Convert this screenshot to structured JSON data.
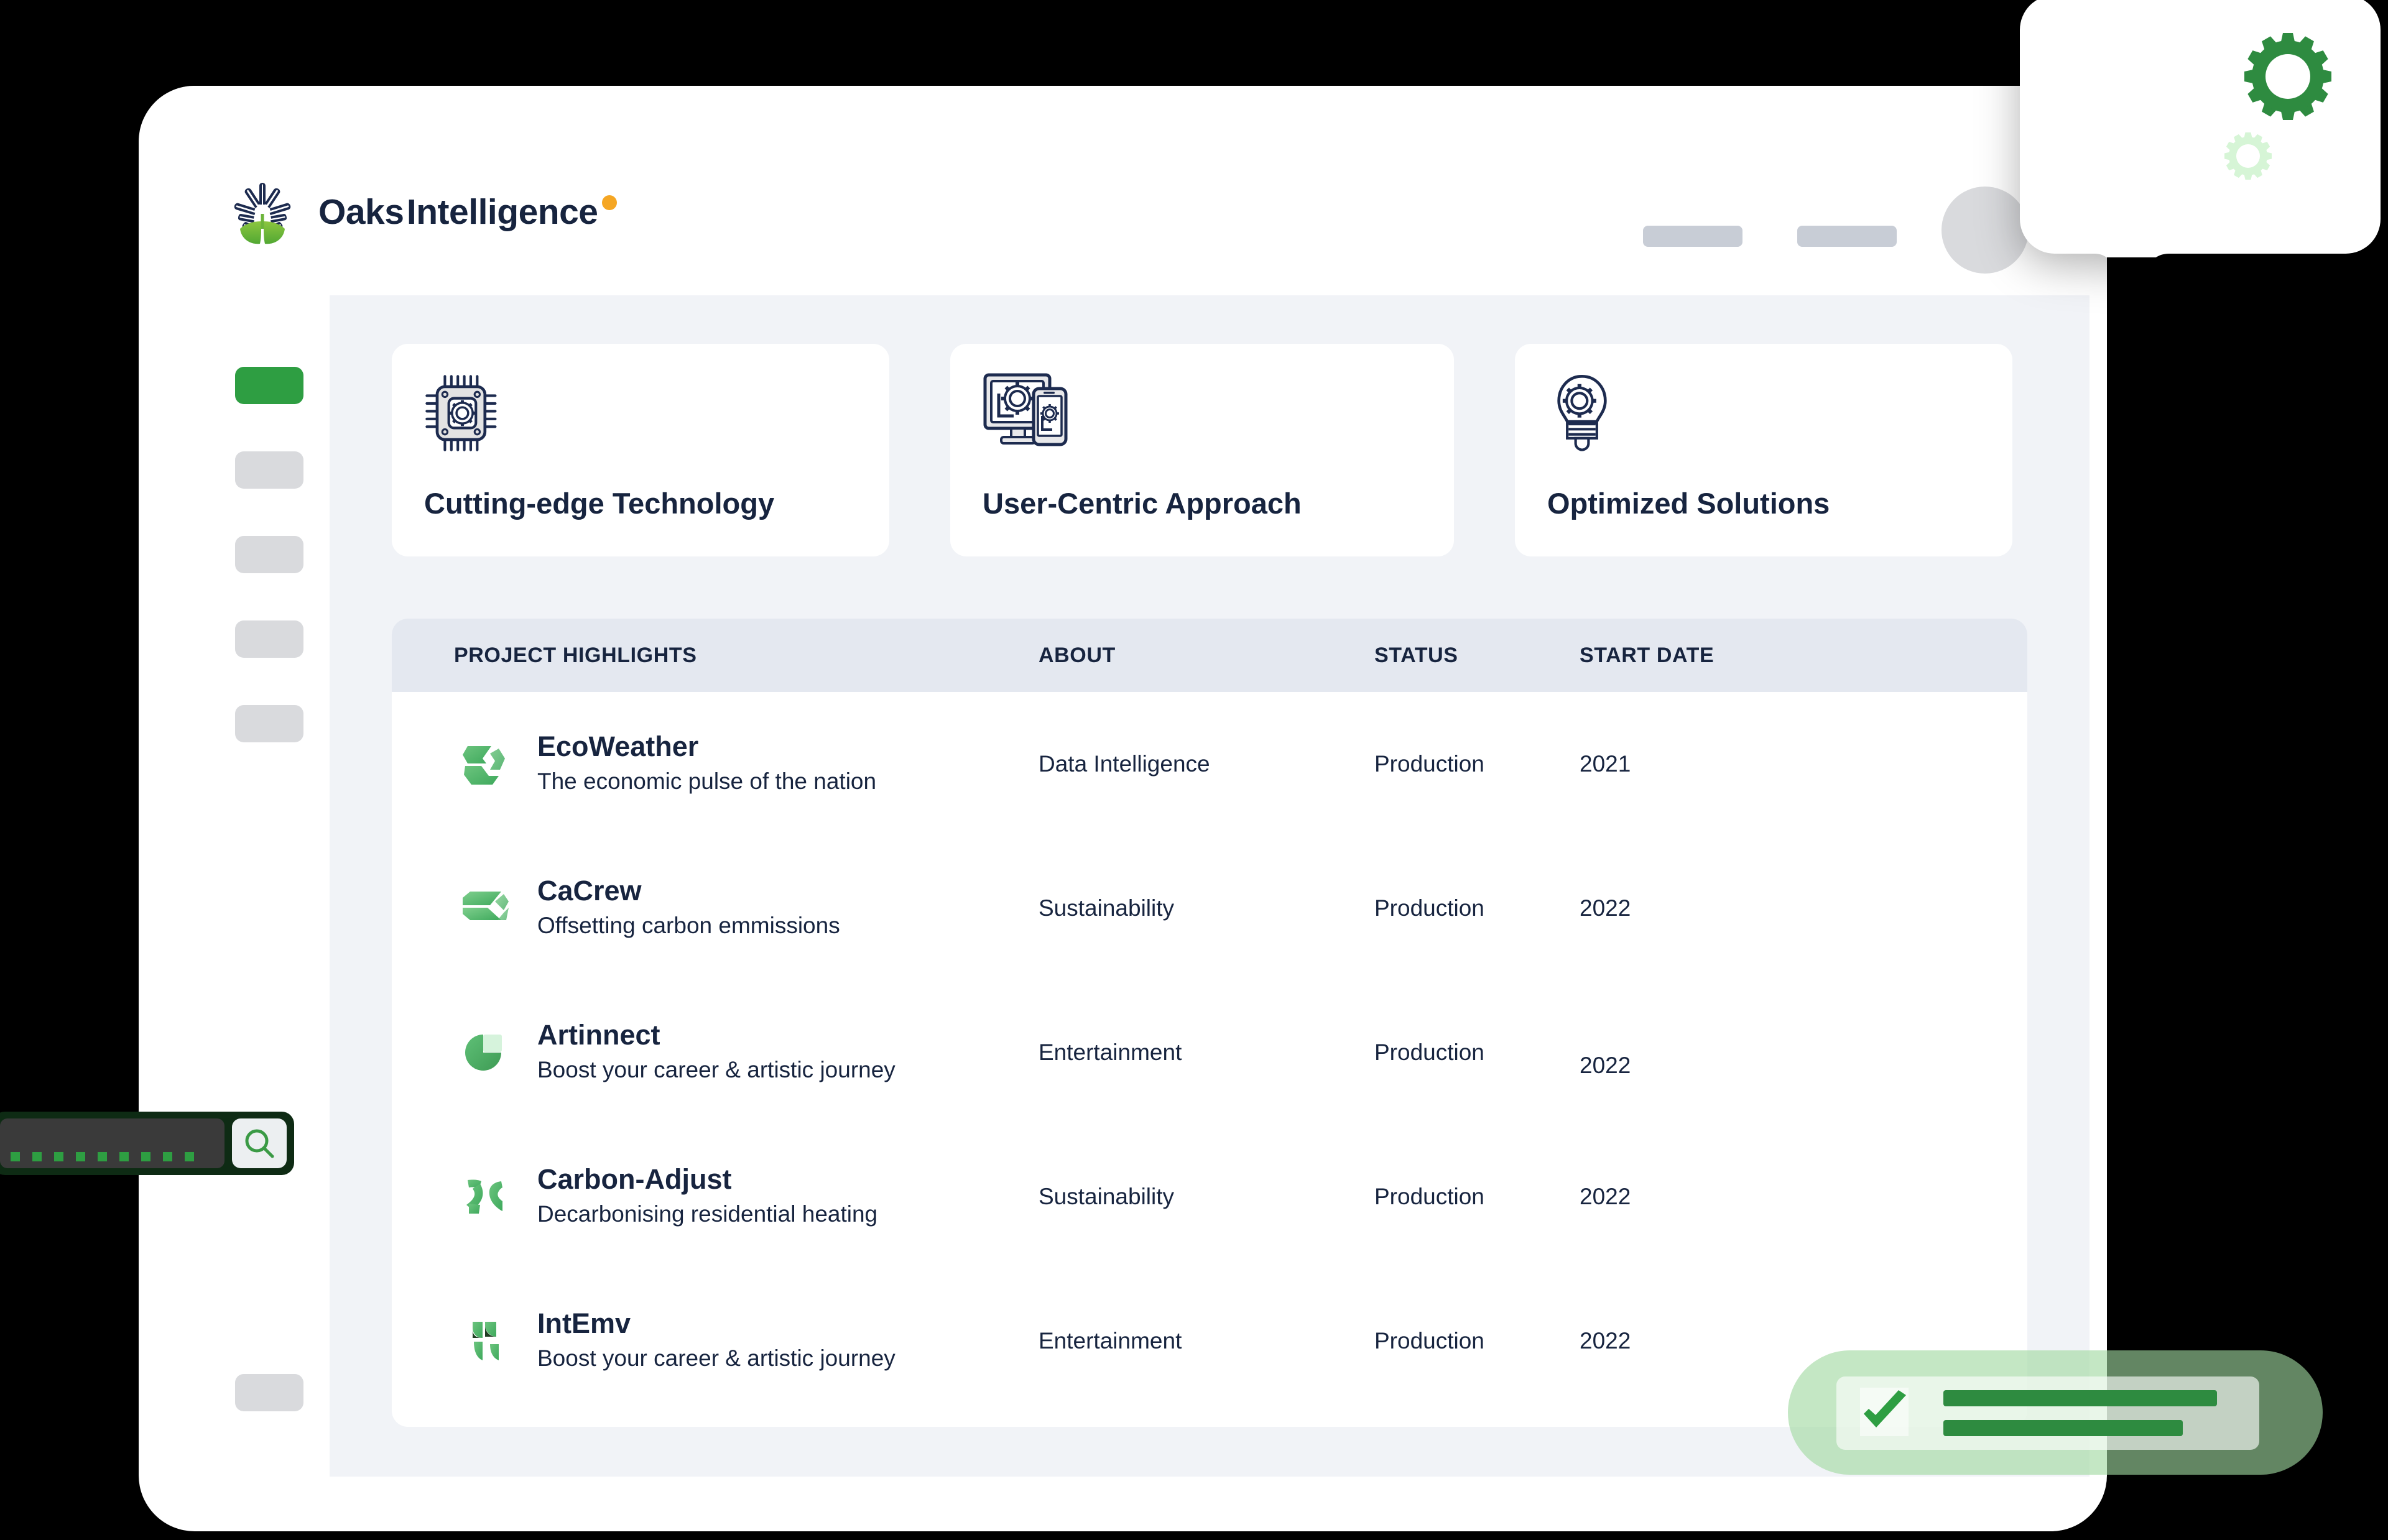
{
  "brand": {
    "line1": "Oaks",
    "line2": "Intelligence",
    "accent_orange": "#f5a623",
    "dark": "#17243f",
    "green": "#2e9e42"
  },
  "header": {
    "placeholder_pill_1": "",
    "placeholder_pill_2": "",
    "avatar_label": ""
  },
  "sidebar": {
    "items": [
      {
        "label": "",
        "active": true
      },
      {
        "label": "",
        "active": false
      },
      {
        "label": "",
        "active": false
      },
      {
        "label": "",
        "active": false
      },
      {
        "label": "",
        "active": false
      },
      {
        "label": "",
        "active": false
      }
    ]
  },
  "features": [
    {
      "label": "Cutting-edge Technology",
      "icon": "microchip-gear-icon"
    },
    {
      "label": "User-Centric Approach",
      "icon": "monitor-phone-gear-icon"
    },
    {
      "label": "Optimized Solutions",
      "icon": "lightbulb-gear-icon"
    }
  ],
  "table": {
    "columns": [
      "PROJECT HIGHLIGHTS",
      "ABOUT",
      "STATUS",
      "START DATE"
    ],
    "rows": [
      {
        "name": "EcoWeather",
        "desc": "The economic pulse of the nation",
        "about": "Data Intelligence",
        "status": "Production",
        "start_date": "2021",
        "icon": "ecoweather-logo-icon"
      },
      {
        "name": "CaCrew",
        "desc": "Offsetting carbon emmissions",
        "about": "Sustainability",
        "status": "Production",
        "start_date": "2022",
        "icon": "cacrew-logo-icon"
      },
      {
        "name": "Artinnect",
        "desc": "Boost your career & artistic journey",
        "about": "Entertainment",
        "status": "Production",
        "start_date": "2022",
        "icon": "artinnect-logo-icon"
      },
      {
        "name": "Carbon-Adjust",
        "desc": "Decarbonising residential heating",
        "about": "Sustainability",
        "status": "Production",
        "start_date": "2022",
        "icon": "carbon-adjust-logo-icon"
      },
      {
        "name": "IntEmv",
        "desc": "Boost your career & artistic journey",
        "about": "Entertainment",
        "status": "Production",
        "start_date": "2022",
        "icon": "intemv-logo-icon"
      }
    ]
  },
  "floating": {
    "tooltip": {
      "icon_large": "gear-icon",
      "icon_small": "gear-icon",
      "color_large": "#2e8b40",
      "color_small": "#d6f5d6"
    },
    "search": {
      "value": "•••••••••",
      "placeholder": "",
      "icon": "search-icon"
    },
    "check": {
      "icon": "checkmark-icon",
      "line1": "",
      "line2": ""
    }
  }
}
